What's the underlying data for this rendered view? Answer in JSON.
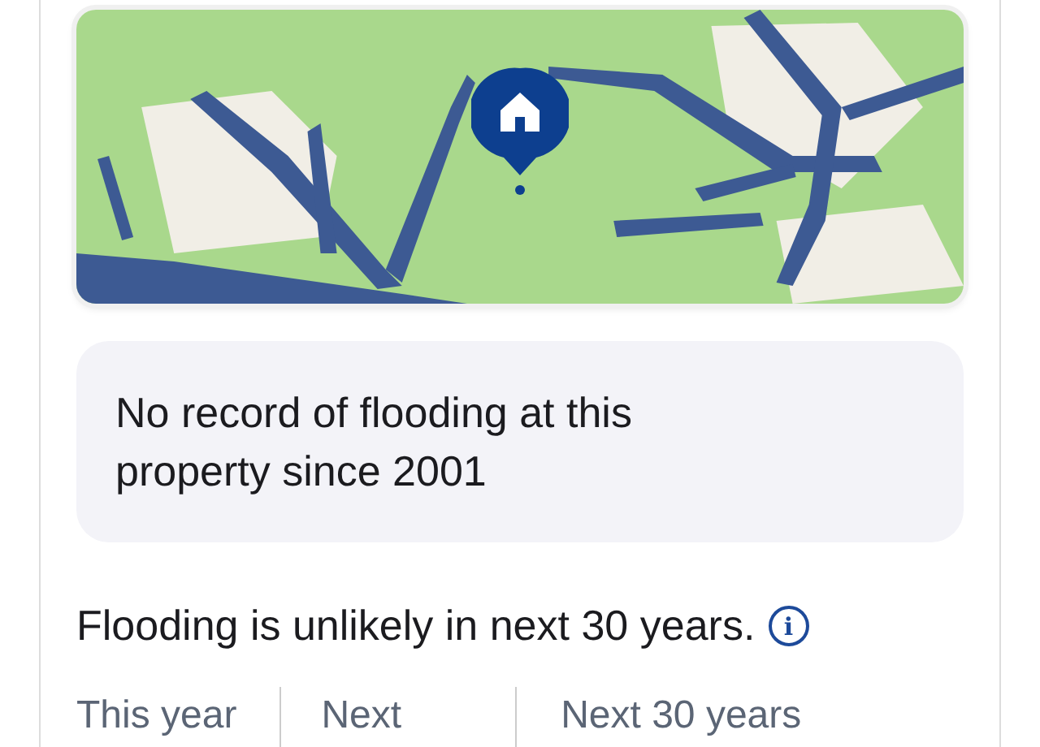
{
  "flood_history": {
    "message": "No record of flooding at this property since 2001"
  },
  "forecast": {
    "summary": "Flooding is unlikely in next 30 years.",
    "info_icon": "i"
  },
  "tabs": [
    {
      "label": "This year",
      "selected": false
    },
    {
      "label": "Next",
      "selected": false
    },
    {
      "label": "Next 30 years",
      "selected": false
    }
  ]
}
